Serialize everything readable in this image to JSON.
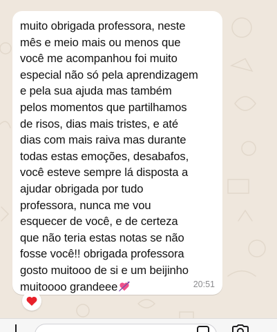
{
  "message": {
    "text": "muito obrigada professora, neste\nmês e meio mais ou menos que\nvocê me acompanhou foi muito\nespecial não só pela aprendizagem\ne pela sua ajuda mas também\npelos momentos que partilhamos\nde risos, dias mais tristes, e até\ndias com mais raiva mas durante\ntodas estas emoções, desabafos,\nvocê esteve sempre lá disposta a\najudar obrigada por tudo\nprofessora, nunca me vou\nesquecer de você, e de certeza\nque não teria estas notas se não\nfosse você!! obrigada professora\ngosto muitooo de si e um beijinho\nmuitoooo grandeee",
    "emoji": "heart-with-arrow-icon",
    "time": "20:51"
  },
  "reaction": {
    "emoji": "red-heart-icon"
  },
  "composer": {
    "icons": [
      "plus-icon",
      "sticker-icon",
      "camera-icon"
    ]
  },
  "colors": {
    "background": "#EFE7DD",
    "bubble": "#FFFFFF",
    "text": "#111111",
    "timestamp": "#8A8A8D",
    "heart": "#E8202A"
  }
}
